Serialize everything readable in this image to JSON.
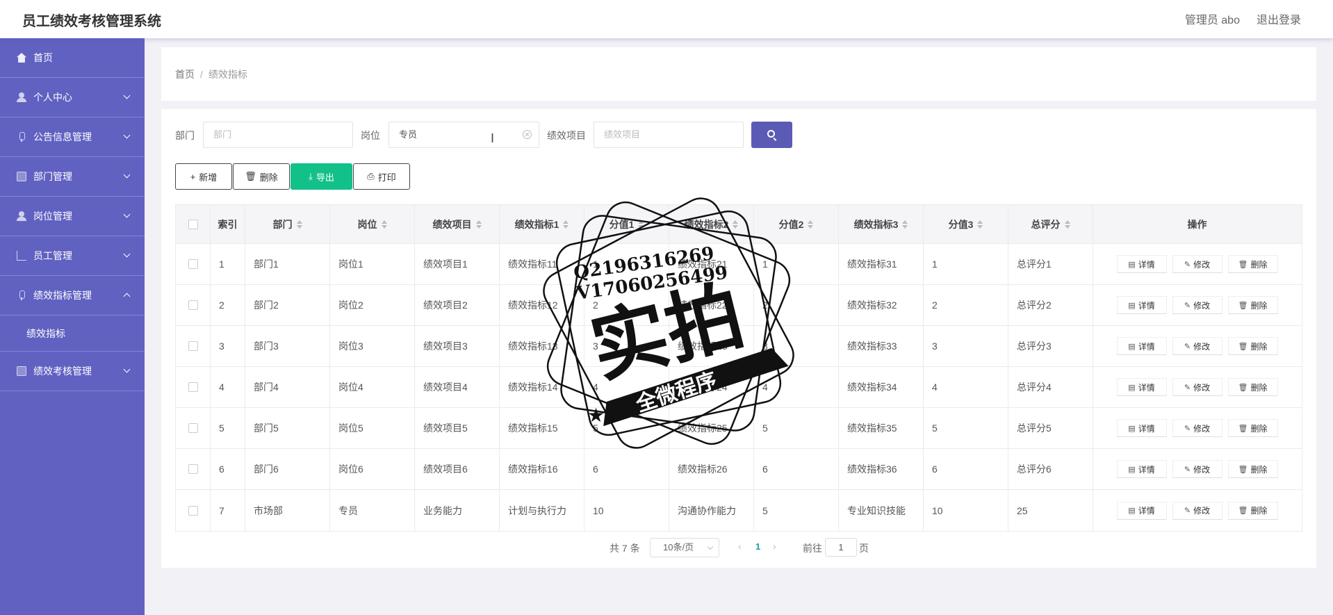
{
  "header": {
    "title": "员工绩效考核管理系统",
    "user": "管理员 abo",
    "logout": "退出登录"
  },
  "sidebar": {
    "items": [
      {
        "label": "首页"
      },
      {
        "label": "个人中心"
      },
      {
        "label": "公告信息管理"
      },
      {
        "label": "部门管理"
      },
      {
        "label": "岗位管理"
      },
      {
        "label": "员工管理"
      },
      {
        "label": "绩效指标管理"
      },
      {
        "label": "绩效考核管理"
      }
    ],
    "sub_item": "绩效指标"
  },
  "breadcrumb": {
    "home": "首页",
    "sep": "/",
    "current": "绩效指标"
  },
  "filters": {
    "dept_label": "部门",
    "dept_placeholder": "部门",
    "post_label": "岗位",
    "post_value": "专员",
    "project_label": "绩效项目",
    "project_placeholder": "绩效项目"
  },
  "toolbar": {
    "add": "新增",
    "delete": "删除",
    "export": "导出",
    "print": "打印",
    "export_color": "#12c08a"
  },
  "table": {
    "headers": [
      "索引",
      "部门",
      "岗位",
      "绩效项目",
      "绩效指标1",
      "分值1",
      "绩效指标2",
      "分值2",
      "绩效指标3",
      "分值3",
      "总评分",
      "操作"
    ],
    "rows": [
      [
        "1",
        "部门1",
        "岗位1",
        "绩效项目1",
        "绩效指标11",
        "1",
        "绩效指标21",
        "1",
        "绩效指标31",
        "1",
        "总评分1"
      ],
      [
        "2",
        "部门2",
        "岗位2",
        "绩效项目2",
        "绩效指标12",
        "2",
        "绩效指标22",
        "2",
        "绩效指标32",
        "2",
        "总评分2"
      ],
      [
        "3",
        "部门3",
        "岗位3",
        "绩效项目3",
        "绩效指标13",
        "3",
        "绩效指标23",
        "3",
        "绩效指标33",
        "3",
        "总评分3"
      ],
      [
        "4",
        "部门4",
        "岗位4",
        "绩效项目4",
        "绩效指标14",
        "4",
        "绩效指标24",
        "4",
        "绩效指标34",
        "4",
        "总评分4"
      ],
      [
        "5",
        "部门5",
        "岗位5",
        "绩效项目5",
        "绩效指标15",
        "5",
        "绩效指标25",
        "5",
        "绩效指标35",
        "5",
        "总评分5"
      ],
      [
        "6",
        "部门6",
        "岗位6",
        "绩效项目6",
        "绩效指标16",
        "6",
        "绩效指标26",
        "6",
        "绩效指标36",
        "6",
        "总评分6"
      ],
      [
        "7",
        "市场部",
        "专员",
        "业务能力",
        "计划与执行力",
        "10",
        "沟通协作能力",
        "5",
        "专业知识技能",
        "10",
        "25"
      ]
    ],
    "ops": {
      "detail": "详情",
      "edit": "修改",
      "delete": "删除"
    }
  },
  "pagination": {
    "total": "共 7 条",
    "page_size": "10条/页",
    "current": "1",
    "goto": "前往",
    "goto_value": "1",
    "page_suffix": "页"
  },
  "watermark": {
    "line1": "Q2196316269",
    "line2": "V17060256499",
    "main": "实拍",
    "banner": "全微程序"
  },
  "colors": {
    "sidebar": "#6161c2",
    "primary": "#5b5bb5"
  }
}
